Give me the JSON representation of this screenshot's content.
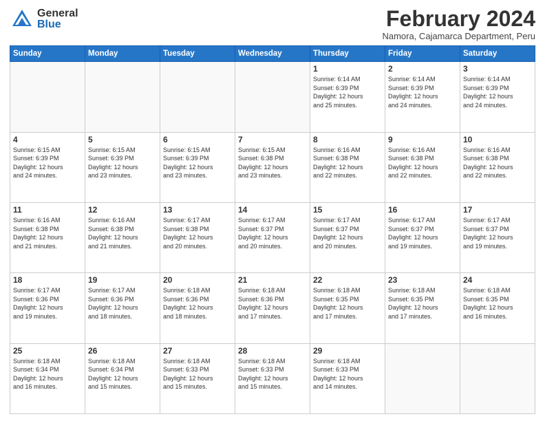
{
  "header": {
    "logo_general": "General",
    "logo_blue": "Blue",
    "month_title": "February 2024",
    "location": "Namora, Cajamarca Department, Peru"
  },
  "weekdays": [
    "Sunday",
    "Monday",
    "Tuesday",
    "Wednesday",
    "Thursday",
    "Friday",
    "Saturday"
  ],
  "weeks": [
    [
      {
        "day": "",
        "info": ""
      },
      {
        "day": "",
        "info": ""
      },
      {
        "day": "",
        "info": ""
      },
      {
        "day": "",
        "info": ""
      },
      {
        "day": "1",
        "info": "Sunrise: 6:14 AM\nSunset: 6:39 PM\nDaylight: 12 hours\nand 25 minutes."
      },
      {
        "day": "2",
        "info": "Sunrise: 6:14 AM\nSunset: 6:39 PM\nDaylight: 12 hours\nand 24 minutes."
      },
      {
        "day": "3",
        "info": "Sunrise: 6:14 AM\nSunset: 6:39 PM\nDaylight: 12 hours\nand 24 minutes."
      }
    ],
    [
      {
        "day": "4",
        "info": "Sunrise: 6:15 AM\nSunset: 6:39 PM\nDaylight: 12 hours\nand 24 minutes."
      },
      {
        "day": "5",
        "info": "Sunrise: 6:15 AM\nSunset: 6:39 PM\nDaylight: 12 hours\nand 23 minutes."
      },
      {
        "day": "6",
        "info": "Sunrise: 6:15 AM\nSunset: 6:39 PM\nDaylight: 12 hours\nand 23 minutes."
      },
      {
        "day": "7",
        "info": "Sunrise: 6:15 AM\nSunset: 6:38 PM\nDaylight: 12 hours\nand 23 minutes."
      },
      {
        "day": "8",
        "info": "Sunrise: 6:16 AM\nSunset: 6:38 PM\nDaylight: 12 hours\nand 22 minutes."
      },
      {
        "day": "9",
        "info": "Sunrise: 6:16 AM\nSunset: 6:38 PM\nDaylight: 12 hours\nand 22 minutes."
      },
      {
        "day": "10",
        "info": "Sunrise: 6:16 AM\nSunset: 6:38 PM\nDaylight: 12 hours\nand 22 minutes."
      }
    ],
    [
      {
        "day": "11",
        "info": "Sunrise: 6:16 AM\nSunset: 6:38 PM\nDaylight: 12 hours\nand 21 minutes."
      },
      {
        "day": "12",
        "info": "Sunrise: 6:16 AM\nSunset: 6:38 PM\nDaylight: 12 hours\nand 21 minutes."
      },
      {
        "day": "13",
        "info": "Sunrise: 6:17 AM\nSunset: 6:38 PM\nDaylight: 12 hours\nand 20 minutes."
      },
      {
        "day": "14",
        "info": "Sunrise: 6:17 AM\nSunset: 6:37 PM\nDaylight: 12 hours\nand 20 minutes."
      },
      {
        "day": "15",
        "info": "Sunrise: 6:17 AM\nSunset: 6:37 PM\nDaylight: 12 hours\nand 20 minutes."
      },
      {
        "day": "16",
        "info": "Sunrise: 6:17 AM\nSunset: 6:37 PM\nDaylight: 12 hours\nand 19 minutes."
      },
      {
        "day": "17",
        "info": "Sunrise: 6:17 AM\nSunset: 6:37 PM\nDaylight: 12 hours\nand 19 minutes."
      }
    ],
    [
      {
        "day": "18",
        "info": "Sunrise: 6:17 AM\nSunset: 6:36 PM\nDaylight: 12 hours\nand 19 minutes."
      },
      {
        "day": "19",
        "info": "Sunrise: 6:17 AM\nSunset: 6:36 PM\nDaylight: 12 hours\nand 18 minutes."
      },
      {
        "day": "20",
        "info": "Sunrise: 6:18 AM\nSunset: 6:36 PM\nDaylight: 12 hours\nand 18 minutes."
      },
      {
        "day": "21",
        "info": "Sunrise: 6:18 AM\nSunset: 6:36 PM\nDaylight: 12 hours\nand 17 minutes."
      },
      {
        "day": "22",
        "info": "Sunrise: 6:18 AM\nSunset: 6:35 PM\nDaylight: 12 hours\nand 17 minutes."
      },
      {
        "day": "23",
        "info": "Sunrise: 6:18 AM\nSunset: 6:35 PM\nDaylight: 12 hours\nand 17 minutes."
      },
      {
        "day": "24",
        "info": "Sunrise: 6:18 AM\nSunset: 6:35 PM\nDaylight: 12 hours\nand 16 minutes."
      }
    ],
    [
      {
        "day": "25",
        "info": "Sunrise: 6:18 AM\nSunset: 6:34 PM\nDaylight: 12 hours\nand 16 minutes."
      },
      {
        "day": "26",
        "info": "Sunrise: 6:18 AM\nSunset: 6:34 PM\nDaylight: 12 hours\nand 15 minutes."
      },
      {
        "day": "27",
        "info": "Sunrise: 6:18 AM\nSunset: 6:33 PM\nDaylight: 12 hours\nand 15 minutes."
      },
      {
        "day": "28",
        "info": "Sunrise: 6:18 AM\nSunset: 6:33 PM\nDaylight: 12 hours\nand 15 minutes."
      },
      {
        "day": "29",
        "info": "Sunrise: 6:18 AM\nSunset: 6:33 PM\nDaylight: 12 hours\nand 14 minutes."
      },
      {
        "day": "",
        "info": ""
      },
      {
        "day": "",
        "info": ""
      }
    ]
  ]
}
